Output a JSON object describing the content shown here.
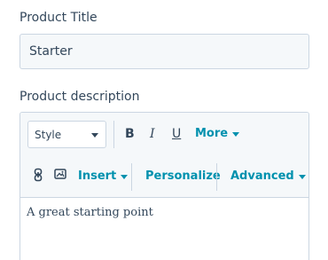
{
  "product_title": {
    "label": "Product Title",
    "value": "Starter"
  },
  "product_description": {
    "label": "Product description",
    "toolbar": {
      "style_select": "Style",
      "bold": "B",
      "italic": "I",
      "underline": "U",
      "more": "More",
      "insert": "Insert",
      "personalize": "Personalize",
      "advanced": "Advanced"
    },
    "content": "A great starting point"
  },
  "colors": {
    "label_text": "#33475b",
    "accent": "#0091ae",
    "border": "#cbd6e2",
    "field_bg": "#f5f8fa"
  },
  "icons": {
    "link": "link-icon",
    "image": "image-icon"
  }
}
